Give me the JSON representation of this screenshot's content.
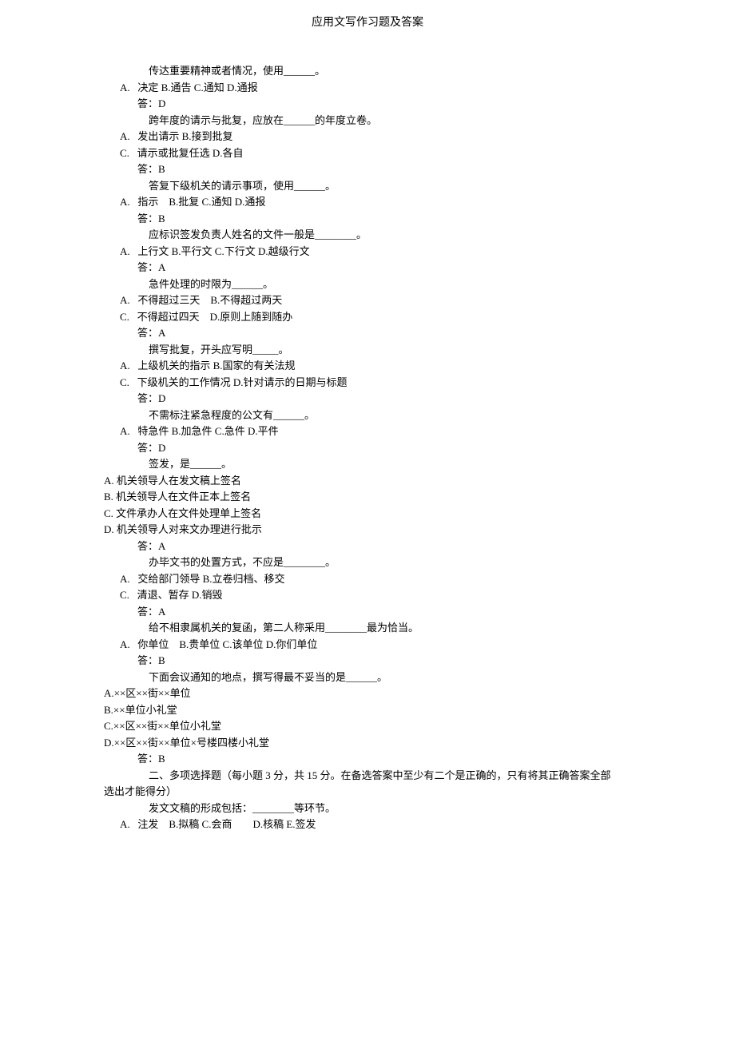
{
  "title": "应用文写作习题及答案",
  "lines": [
    {
      "cls": "indent-1",
      "text": "传达重要精神或者情况，使用______。"
    },
    {
      "cls": "indent-opt",
      "text": "A.   决定 B.通告 C.通知 D.通报"
    },
    {
      "cls": "indent-ans",
      "text": "答：D"
    },
    {
      "cls": "indent-1",
      "text": "跨年度的请示与批复，应放在______的年度立卷。"
    },
    {
      "cls": "indent-opt",
      "text": "A.   发出请示 B.接到批复"
    },
    {
      "cls": "indent-opt",
      "text": "C.   请示或批复任选 D.各自"
    },
    {
      "cls": "indent-ans",
      "text": "答：B"
    },
    {
      "cls": "indent-1",
      "text": "答复下级机关的请示事项，使用______。"
    },
    {
      "cls": "indent-opt",
      "text": "A.   指示    B.批复 C.通知 D.通报"
    },
    {
      "cls": "indent-ans",
      "text": "答：B"
    },
    {
      "cls": "indent-1",
      "text": "应标识签发负责人姓名的文件一般是________。"
    },
    {
      "cls": "indent-opt",
      "text": "A.   上行文 B.平行文 C.下行文 D.越级行文"
    },
    {
      "cls": "indent-ans",
      "text": "答：A"
    },
    {
      "cls": "indent-1",
      "text": "急件处理的时限为______。"
    },
    {
      "cls": "indent-opt",
      "text": "A.   不得超过三天    B.不得超过两天"
    },
    {
      "cls": "indent-opt",
      "text": "C.   不得超过四天    D.原则上随到随办"
    },
    {
      "cls": "indent-ans",
      "text": "答：A"
    },
    {
      "cls": "indent-1",
      "text": "撰写批复，开头应写明_____。"
    },
    {
      "cls": "indent-opt",
      "text": "A.   上级机关的指示 B.国家的有关法规"
    },
    {
      "cls": "indent-opt",
      "text": "C.   下级机关的工作情况 D.针对请示的日期与标题"
    },
    {
      "cls": "indent-ans",
      "text": "答：D"
    },
    {
      "cls": "indent-1",
      "text": "不需标注紧急程度的公文有______。"
    },
    {
      "cls": "indent-opt",
      "text": "A.   特急件 B.加急件 C.急件 D.平件"
    },
    {
      "cls": "indent-ans",
      "text": "答：D"
    },
    {
      "cls": "indent-1",
      "text": "签发，是______。"
    },
    {
      "cls": "indent-0",
      "text": "A. 机关领导人在发文稿上签名"
    },
    {
      "cls": "indent-0",
      "text": "B. 机关领导人在文件正本上签名"
    },
    {
      "cls": "indent-0",
      "text": "C. 文件承办人在文件处理单上签名"
    },
    {
      "cls": "indent-0",
      "text": "D. 机关领导人对来文办理进行批示"
    },
    {
      "cls": "indent-ans",
      "text": "答：A"
    },
    {
      "cls": "indent-1",
      "text": "办毕文书的处置方式，不应是________。"
    },
    {
      "cls": "indent-opt",
      "text": "A.   交给部门领导 B.立卷归档、移交"
    },
    {
      "cls": "indent-opt",
      "text": "C.   清退、暂存 D.销毁"
    },
    {
      "cls": "indent-ans",
      "text": "答：A"
    },
    {
      "cls": "indent-1",
      "text": "给不相隶属机关的复函，第二人称采用________最为恰当。"
    },
    {
      "cls": "indent-opt",
      "text": "A.   你单位    B.贵单位 C.该单位 D.你们单位"
    },
    {
      "cls": "indent-ans",
      "text": "答：B"
    },
    {
      "cls": "indent-1",
      "text": "下面会议通知的地点，撰写得最不妥当的是______。"
    },
    {
      "cls": "indent-0",
      "text": "A.××区××街××单位"
    },
    {
      "cls": "indent-0",
      "text": "B.××单位小礼堂"
    },
    {
      "cls": "indent-0",
      "text": "C.××区××街××单位小礼堂"
    },
    {
      "cls": "indent-0",
      "text": "D.××区××街××单位×号楼四楼小礼堂"
    },
    {
      "cls": "indent-ans",
      "text": "答：B"
    },
    {
      "cls": "indent-1",
      "text": "二、多项选择题（每小题 3 分，共 15 分。在备选答案中至少有二个是正确的，只有将其正确答案全部"
    },
    {
      "cls": "indent-0",
      "text": "选出才能得分）"
    },
    {
      "cls": "indent-1",
      "text": "发文文稿的形成包括：________等环节。"
    },
    {
      "cls": "indent-opt",
      "text": "A.   注发    B.拟稿 C.会商        D.核稿 E.签发"
    }
  ]
}
